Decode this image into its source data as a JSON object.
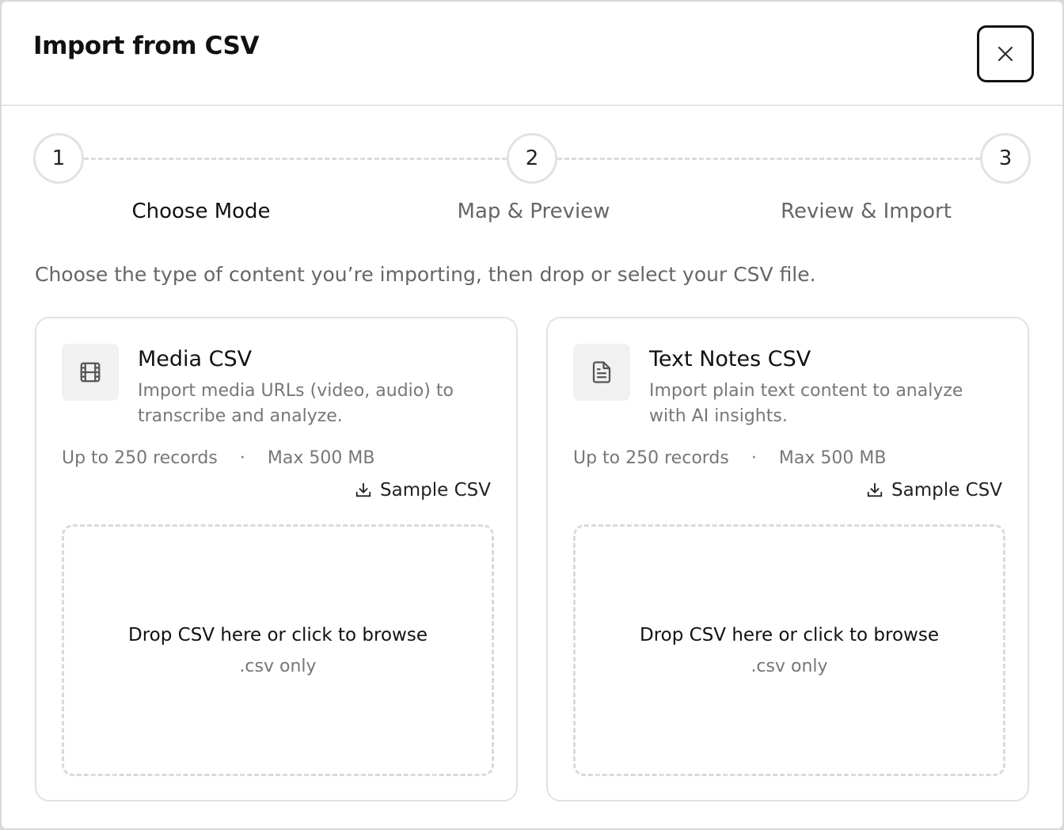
{
  "dialog": {
    "title": "Import from CSV",
    "close_icon": "close-icon"
  },
  "stepper": {
    "steps": [
      {
        "number": "1",
        "label": "Choose Mode",
        "active": true
      },
      {
        "number": "2",
        "label": "Map & Preview",
        "active": false
      },
      {
        "number": "3",
        "label": "Review & Import",
        "active": false
      }
    ]
  },
  "intro_text": "Choose the type of content you’re importing, then drop or select your CSV file.",
  "cards": [
    {
      "icon": "film-icon",
      "title": "Media CSV",
      "description": "Import media URLs (video, audio) to transcribe and analyze.",
      "records": "Up to 250 records",
      "separator": "·",
      "max_size": "Max 500 MB",
      "sample_label": "Sample CSV",
      "sample_icon": "download-icon",
      "drop_main": "Drop CSV here or click to browse",
      "drop_sub": ".csv only"
    },
    {
      "icon": "document-icon",
      "title": "Text Notes CSV",
      "description": "Import plain text content to analyze with AI insights.",
      "records": "Up to 250 records",
      "separator": "·",
      "max_size": "Max 500 MB",
      "sample_label": "Sample CSV",
      "sample_icon": "download-icon",
      "drop_main": "Drop CSV here or click to browse",
      "drop_sub": ".csv only"
    }
  ],
  "colors": {
    "border": "#e2e2e2",
    "muted_text": "#777777",
    "primary_text": "#111111"
  }
}
